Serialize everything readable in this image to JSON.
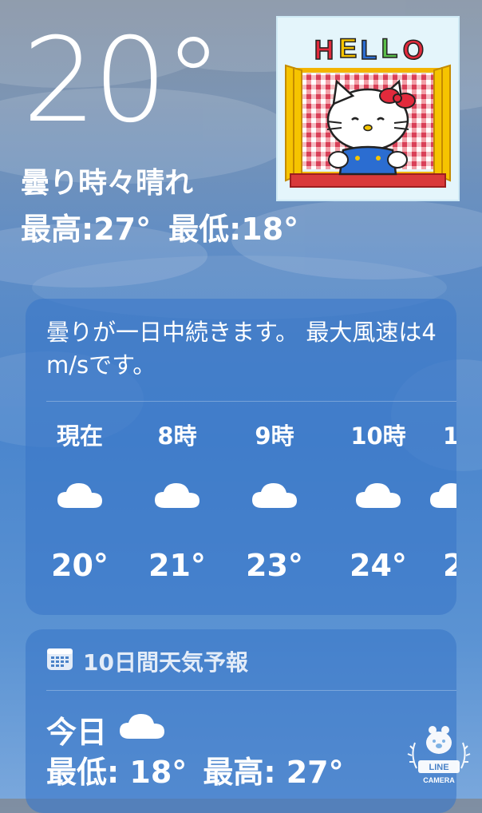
{
  "current": {
    "temperature": "20°",
    "condition": "曇り時々晴れ",
    "high": "最高:27°",
    "low": "最低:18°"
  },
  "sticker": {
    "text": "HELLO"
  },
  "hourly_card": {
    "summary": "曇りが一日中続きます。 最大風速は4 m/sです。",
    "hours": [
      {
        "label": "現在",
        "icon": "cloud-icon",
        "temp": "20°"
      },
      {
        "label": "8時",
        "icon": "cloud-icon",
        "temp": "21°"
      },
      {
        "label": "9時",
        "icon": "cloud-icon",
        "temp": "23°"
      },
      {
        "label": "10時",
        "icon": "cloud-icon",
        "temp": "24°"
      },
      {
        "label": "1",
        "icon": "cloud-icon",
        "temp": "2"
      }
    ]
  },
  "forecast_card": {
    "header_icon": "calendar-icon",
    "title": "10日間天気予報",
    "today": {
      "day": "今日",
      "icon": "cloud-icon",
      "low": "最低: 18°",
      "high": "最高: 27°"
    }
  },
  "watermark": {
    "brand": "LINE",
    "sub": "CAMERA"
  }
}
